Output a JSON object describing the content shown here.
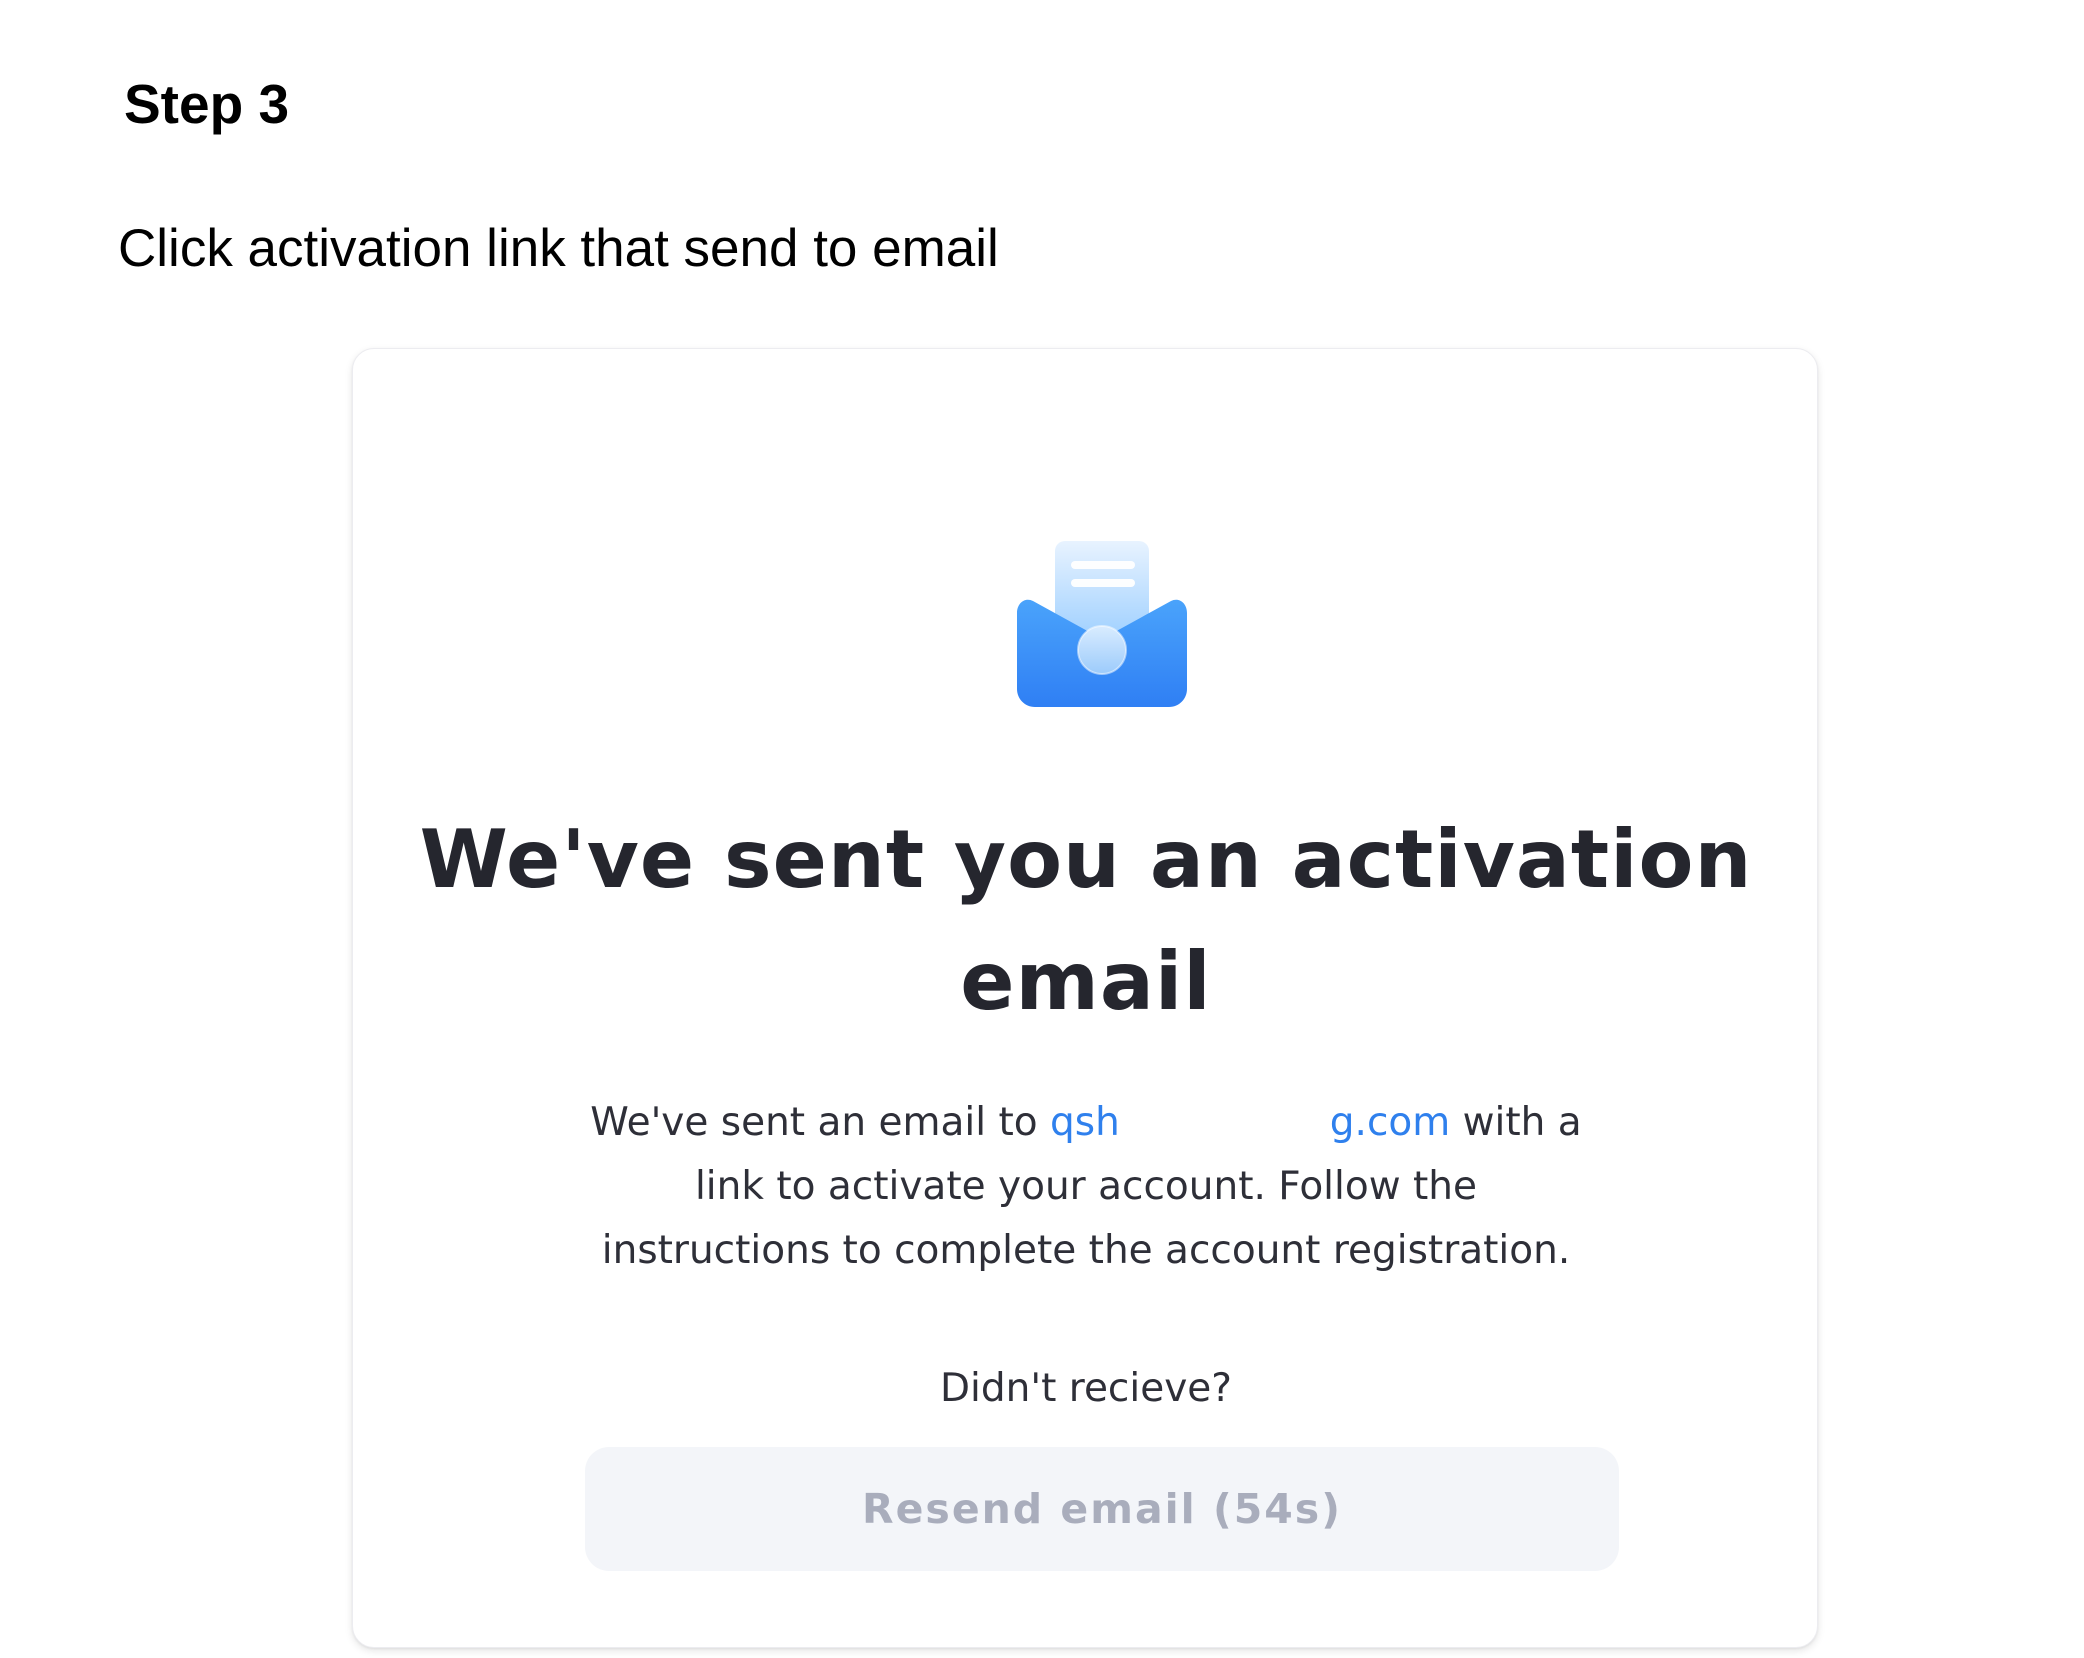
{
  "page": {
    "step_title": "Step 3",
    "step_description": "Click activation link that send to email"
  },
  "card": {
    "icon": "open-mail-icon",
    "title": "We've sent you an activation email",
    "body_prefix": "We've sent an email to ",
    "email_start": "qsh",
    "email_end": "g.com",
    "body_suffix": " with a link to activate your account. Follow the instructions to complete the account registration.",
    "didnt_receive": "Didn't recieve?",
    "resend_label": "Resend email (54s)",
    "resend_countdown_seconds": 54
  },
  "colors": {
    "link": "#2f80ed",
    "title": "#25262e",
    "icon_blue": "#2f86f6",
    "button_bg": "#f3f5f9",
    "button_text": "#a9adbc"
  }
}
